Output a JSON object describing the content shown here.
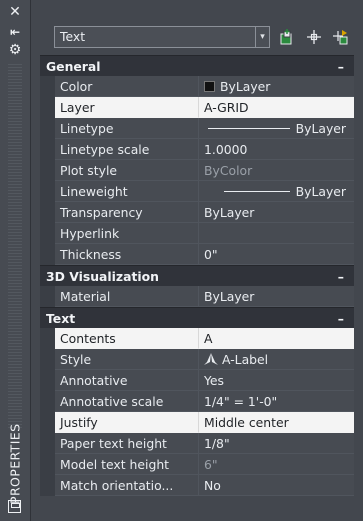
{
  "strip": {
    "close_glyph": "✕",
    "autohide_glyph": "⇤",
    "settings_glyph": "⚙",
    "title": "PROPERTIES"
  },
  "toolbar": {
    "selection": "Text",
    "dropdown_glyph": "▾"
  },
  "sections": {
    "general": {
      "title": "General",
      "collapse": "–",
      "rows": [
        {
          "name": "Color",
          "value": "ByLayer"
        },
        {
          "name": "Layer",
          "value": "A-GRID"
        },
        {
          "name": "Linetype",
          "value": "ByLayer"
        },
        {
          "name": "Linetype scale",
          "value": "1.0000"
        },
        {
          "name": "Plot style",
          "value": "ByColor"
        },
        {
          "name": "Lineweight",
          "value": "ByLayer"
        },
        {
          "name": "Transparency",
          "value": "ByLayer"
        },
        {
          "name": "Hyperlink",
          "value": ""
        },
        {
          "name": "Thickness",
          "value": "0\""
        }
      ]
    },
    "viz": {
      "title": "3D Visualization",
      "collapse": "–",
      "rows": [
        {
          "name": "Material",
          "value": "ByLayer"
        }
      ]
    },
    "text": {
      "title": "Text",
      "collapse": "–",
      "rows": [
        {
          "name": "Contents",
          "value": "A"
        },
        {
          "name": "Style",
          "value": "A-Label"
        },
        {
          "name": "Annotative",
          "value": "Yes"
        },
        {
          "name": "Annotative scale",
          "value": "1/4\" = 1'-0\""
        },
        {
          "name": "Justify",
          "value": "Middle center"
        },
        {
          "name": "Paper text height",
          "value": "1/8\""
        },
        {
          "name": "Model text height",
          "value": "6\""
        },
        {
          "name": "Match orientatio...",
          "value": "No"
        }
      ]
    }
  },
  "colors": {
    "panel_bg": "#43474e",
    "row_bg": "#474b52",
    "header_bg": "#30333a",
    "highlight_bg": "#f4f4f4",
    "dim_text": "#9aa0a8"
  }
}
